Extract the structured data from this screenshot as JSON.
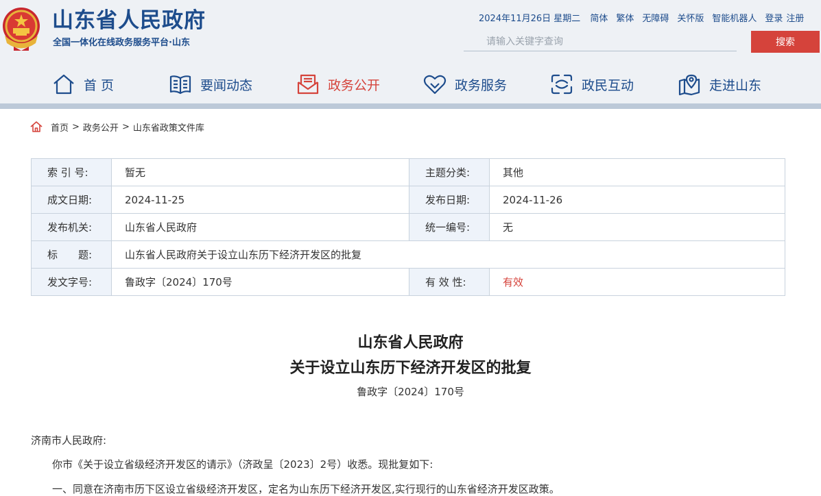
{
  "header": {
    "site_title": "山东省人民政府",
    "site_subtitle": "全国一体化在线政务服务平台·山东",
    "date": "2024年11月26日 星期二",
    "links": [
      "简体",
      "繁体",
      "无障碍",
      "关怀版",
      "智能机器人"
    ],
    "login": "登录",
    "register": "注册",
    "search_placeholder": "请输入关键字查询",
    "search_button": "搜索"
  },
  "nav": {
    "items": [
      {
        "label": "首 页",
        "icon": "home-icon"
      },
      {
        "label": "要闻动态",
        "icon": "book-icon"
      },
      {
        "label": "政务公开",
        "icon": "mail-icon",
        "active": true
      },
      {
        "label": "政务服务",
        "icon": "heart-icon"
      },
      {
        "label": "政民互动",
        "icon": "interaction-icon"
      },
      {
        "label": "走进山东",
        "icon": "map-pin-icon"
      }
    ]
  },
  "breadcrumb": {
    "items": [
      "首页",
      "政务公开",
      "山东省政策文件库"
    ],
    "separator": ">"
  },
  "meta": {
    "rows": [
      {
        "l1": "索 引 号:",
        "v1": "暂无",
        "l2": "主题分类:",
        "v2": "其他"
      },
      {
        "l1": "成文日期:",
        "v1": "2024-11-25",
        "l2": "发布日期:",
        "v2": "2024-11-26"
      },
      {
        "l1": "发布机关:",
        "v1": "山东省人民政府",
        "l2": "统一编号:",
        "v2": "无"
      },
      {
        "l1": "标　　题:",
        "v1": "山东省人民政府关于设立山东历下经济开发区的批复"
      },
      {
        "l1": "发文字号:",
        "v1": "鲁政字〔2024〕170号",
        "l2": "有 效 性:",
        "v2": "有效"
      }
    ]
  },
  "document": {
    "title_line1": "山东省人民政府",
    "title_line2": "关于设立山东历下经济开发区的批复",
    "number": "鲁政字〔2024〕170号",
    "salutation": "济南市人民政府:",
    "paragraphs": [
      "你市《关于设立省级经济开发区的请示》（济政呈〔2023〕2号）收悉。现批复如下:",
      "一、同意在济南市历下区设立省级经济开发区，定名为山东历下经济开发区,实行现行的山东省经济开发区政策。"
    ]
  },
  "colors": {
    "brand_blue": "#1d4c8c",
    "accent_red": "#d5433b",
    "header_bg": "#eef1f5"
  }
}
